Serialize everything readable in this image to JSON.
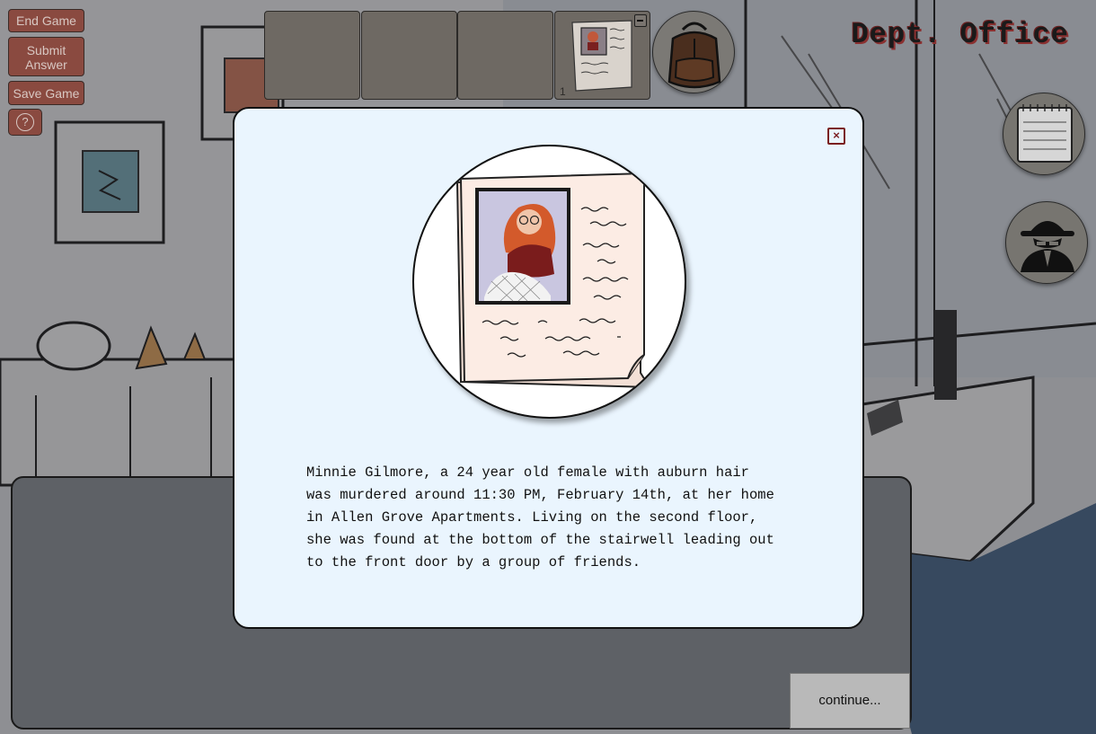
{
  "menu": {
    "end_game": "End Game",
    "submit_answer": "Submit\nAnswer",
    "save_game": "Save Game",
    "help": "?"
  },
  "inventory": {
    "item_count": "1",
    "minimize_icon": "minus-icon",
    "backpack_icon": "backpack-icon"
  },
  "location": {
    "title": "Dept. Office"
  },
  "side_buttons": {
    "notebook_icon": "notebook-icon",
    "detective_icon": "detective-icon"
  },
  "dialogue": {
    "continue_label": "continue..."
  },
  "modal": {
    "close_icon": "close-icon",
    "evidence_icon": "victim-file-icon",
    "text": "Minnie Gilmore, a 24 year old female with auburn hair\nwas murdered around 11:30 PM, February 14th, at her home\nin Allen Grove Apartments. Living on the second floor,\nshe was found at the bottom of the stairwell leading out\nto the front door by a group of friends."
  },
  "colors": {
    "menu_button": "#8a4a40",
    "modal_background": "#eaf5fe",
    "close_border": "#7a1f1f",
    "title_shadow": "#8a3030"
  }
}
